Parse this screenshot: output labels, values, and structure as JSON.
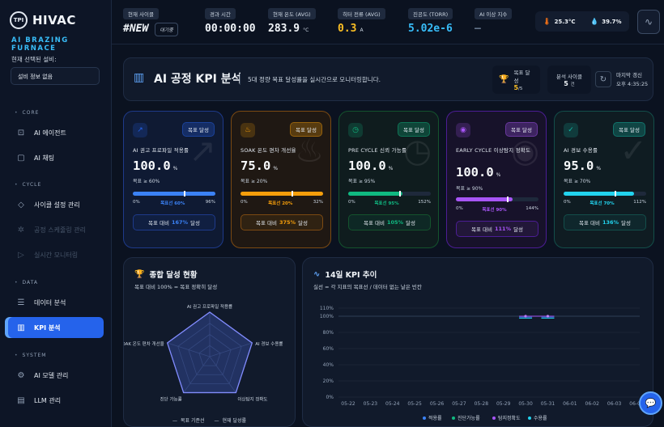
{
  "brand": {
    "logo_text": "TPI",
    "name": "HIVAC",
    "subtitle": "AI BRAZING FURNACE"
  },
  "sidebar": {
    "equipment_label": "현재 선택된 설비:",
    "equipment_value": "설비 정보 없음",
    "sections": {
      "core": "CORE",
      "cycle": "CYCLE",
      "data": "DATA",
      "system": "SYSTEM"
    },
    "items": {
      "ai_agent": "AI 에이전트",
      "ai_chat": "AI 채팅",
      "cycle_setup": "사이클 설정 관리",
      "cycle_control": "공정 스케줄링 관리",
      "realtime_monitor": "실시간 모니터링",
      "data_analysis": "데이터 분석",
      "kpi_analysis": "KPI 분석",
      "ai_model": "AI 모델 관리",
      "llm_manage": "LLM 관리"
    }
  },
  "topbar": {
    "cycle": {
      "label": "현재 사이클",
      "value": "#NEW",
      "badge": "대기중"
    },
    "elapsed": {
      "label": "경과 시간",
      "value": "00:00:00"
    },
    "temp": {
      "label": "현재 온도 (AVG)",
      "value": "283.9",
      "unit": "°C"
    },
    "heater": {
      "label": "히터 전류 (AVG)",
      "value": "0.3",
      "unit": "A"
    },
    "vacuum": {
      "label": "진공도 (TORR)",
      "value": "5.02e-6"
    },
    "ai_index": {
      "label": "AI 이상 지수",
      "value": "—"
    },
    "sensor_temp": "25.3°C",
    "sensor_humidity": "39.7%"
  },
  "header": {
    "title": "AI 공정 KPI 분석",
    "subtitle": "5대 정량 목표 달성률을 실시간으로 모니터링합니다.",
    "goal": {
      "label": "목표 달성",
      "value": "5",
      "unit": "/5"
    },
    "cycles": {
      "label": "분석 사이클",
      "value": "5",
      "unit": "건"
    },
    "last_update_label": "마지막 갱신",
    "last_update_time": "오후 4:35:25"
  },
  "cards": [
    {
      "title": "AI 권고 프로파일 적용률",
      "badge": "목표 달성",
      "value": "100.0",
      "unit": "%",
      "target": "목표 ≥ 60%",
      "min": "0%",
      "mid": "목표선 60%",
      "max": "96%",
      "fill_pct": 100,
      "marker_pct": 62,
      "foot_pre": "목표 대비",
      "foot_val": "167%",
      "foot_post": "달성",
      "color": "#2563eb",
      "fill": "#3b82f6",
      "border": "#1e3a8a",
      "bg": "#0f1a33"
    },
    {
      "title": "SOAK 온도 편차 개선율",
      "badge": "목표 달성",
      "value": "75.0",
      "unit": "%",
      "target": "목표 ≥ 20%",
      "min": "0%",
      "mid": "목표선 20%",
      "max": "32%",
      "fill_pct": 100,
      "marker_pct": 62,
      "foot_pre": "목표 대비",
      "foot_val": "375%",
      "foot_post": "달성",
      "color": "#f59e0b",
      "fill": "#f59e0b",
      "border": "#7c4a12",
      "bg": "#1f1813"
    },
    {
      "title": "PRE CYCLE 신뢰 가능률",
      "badge": "목표 달성",
      "value": "100.0",
      "unit": "%",
      "target": "목표 ≥ 95%",
      "min": "0%",
      "mid": "목표선 95%",
      "max": "152%",
      "fill_pct": 66,
      "marker_pct": 62,
      "foot_pre": "목표 대비",
      "foot_val": "105%",
      "foot_post": "달성",
      "color": "#10b981",
      "fill": "#10b981",
      "border": "#14532d",
      "bg": "#0f1c1e"
    },
    {
      "title": "EARLY CYCLE 이상탐지 정확도",
      "badge": "목표 달성",
      "value": "100.0",
      "unit": "%",
      "target": "목표 ≥ 90%",
      "min": "0%",
      "mid": "목표선 90%",
      "max": "144%",
      "fill_pct": 69,
      "marker_pct": 62,
      "foot_pre": "목표 대비",
      "foot_val": "111%",
      "foot_post": "달성",
      "color": "#a855f7",
      "fill": "#a855f7",
      "border": "#4c1d95",
      "bg": "#17122a"
    },
    {
      "title": "AI 경보 수용률",
      "badge": "목표 달성",
      "value": "95.0",
      "unit": "%",
      "target": "목표 ≥ 70%",
      "min": "0%",
      "mid": "목표선 70%",
      "max": "112%",
      "fill_pct": 85,
      "marker_pct": 62,
      "foot_pre": "목표 대비",
      "foot_val": "136%",
      "foot_post": "달성",
      "color": "#14b8a6",
      "fill": "#22d3ee",
      "border": "#134e4a",
      "bg": "#0f1c22"
    }
  ],
  "radar": {
    "title": "종합 달성 현황",
    "subtitle": "목표 대비 100% = 목표 정확히 달성",
    "axes": [
      "AI 권고 프로파일 적용률",
      "AI 경보 수용률",
      "이상탐지 정확도",
      "진단 가능률",
      "SOAK 온도 편차 개선율"
    ],
    "target_values": [
      100,
      100,
      100,
      100,
      100
    ],
    "actual_values": [
      100,
      100,
      100,
      100,
      100
    ],
    "legend": [
      "목표 기준선",
      "현재 달성률"
    ]
  },
  "trend": {
    "title": "14일 KPI 추이",
    "subtitle": "실선 = 각 지표의 목표선 / 데이터 없는 날은 빈칸",
    "y_ticks": [
      "0%",
      "20%",
      "40%",
      "60%",
      "80%",
      "100%",
      "110%"
    ],
    "x_ticks": [
      "05-22",
      "05-23",
      "05-24",
      "05-25",
      "05-26",
      "05-27",
      "05-28",
      "05-29",
      "05-30",
      "05-31",
      "06-01",
      "06-02",
      "06-03",
      "06-04"
    ],
    "legend": [
      "적용률",
      "진단가능률",
      "탐지정확도",
      "수용률"
    ],
    "legend_colors": [
      "#3b82f6",
      "#10b981",
      "#a855f7",
      "#22d3ee"
    ],
    "points_x": [
      "05-30",
      "05-31"
    ],
    "points_y": [
      100,
      100
    ]
  },
  "chart_data": {
    "type": "line",
    "title": "14일 KPI 추이",
    "x": [
      "05-22",
      "05-23",
      "05-24",
      "05-25",
      "05-26",
      "05-27",
      "05-28",
      "05-29",
      "05-30",
      "05-31",
      "06-01",
      "06-02",
      "06-03",
      "06-04"
    ],
    "series": [
      {
        "name": "탐지정확도",
        "values": [
          null,
          null,
          null,
          null,
          null,
          null,
          null,
          null,
          100,
          100,
          null,
          null,
          null,
          null
        ]
      }
    ],
    "ylim": [
      0,
      110
    ]
  }
}
